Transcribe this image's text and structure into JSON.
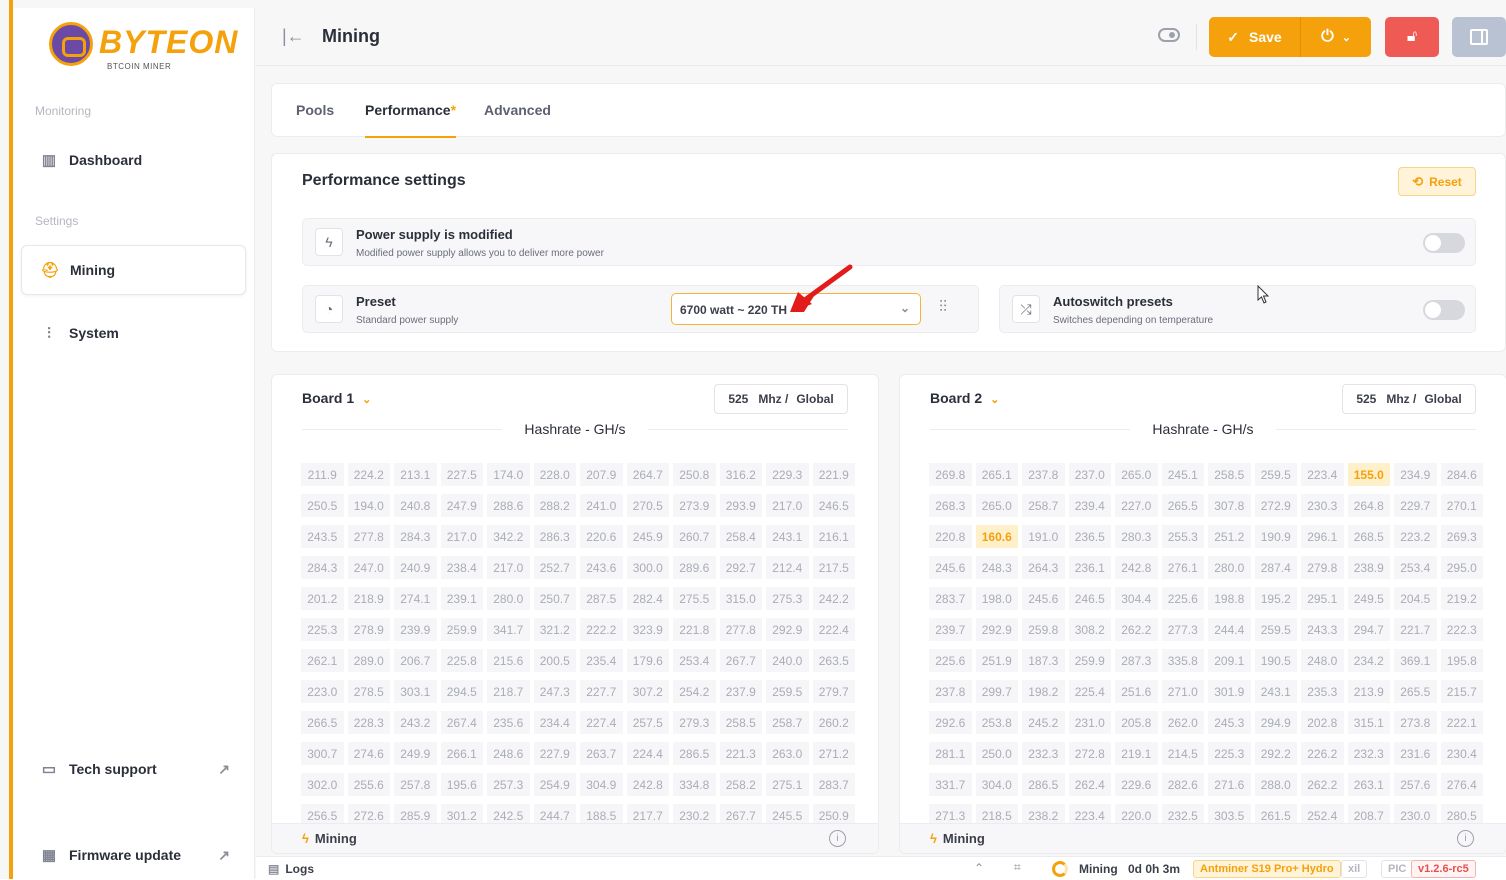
{
  "brand": {
    "name": "BYTEON",
    "tagline": "BTCOIN MINER"
  },
  "sidebar": {
    "sections": [
      "Monitoring",
      "Settings"
    ],
    "items": [
      {
        "label": "Dashboard",
        "icon": "chart-icon"
      },
      {
        "label": "Mining",
        "icon": "helmet-icon",
        "active": true
      },
      {
        "label": "System",
        "icon": "sliders-icon"
      }
    ],
    "bottom": [
      {
        "label": "Tech support",
        "icon": "chat-icon"
      },
      {
        "label": "Firmware update",
        "icon": "chip-icon"
      }
    ]
  },
  "topbar": {
    "title": "Mining",
    "save_label": "Save"
  },
  "tabs": [
    {
      "label": "Pools"
    },
    {
      "label": "Performance",
      "star": "*"
    },
    {
      "label": "Advanced"
    }
  ],
  "performance": {
    "title": "Performance settings",
    "reset_label": "Reset",
    "power_supply": {
      "title": "Power supply is modified",
      "subtitle": "Modified power supply allows you to deliver more power",
      "enabled": false
    },
    "preset": {
      "title": "Preset",
      "subtitle": "Standard power supply",
      "value": "6700 watt ~ 220 TH"
    },
    "autoswitch": {
      "title": "Autoswitch presets",
      "subtitle": "Switches depending on temperature",
      "enabled": false
    }
  },
  "boards": [
    {
      "name": "Board 1",
      "freq": "525",
      "freq_unit": "Mhz /",
      "scope": "Global",
      "hashrate_title": "Hashrate - GH/s",
      "status": "Mining",
      "highlight": [],
      "values": [
        [
          "211.9",
          "224.2",
          "213.1",
          "227.5",
          "174.0",
          "228.0",
          "207.9",
          "264.7",
          "250.8",
          "316.2",
          "229.3",
          "221.9"
        ],
        [
          "250.5",
          "194.0",
          "240.8",
          "247.9",
          "288.6",
          "288.2",
          "241.0",
          "270.5",
          "273.9",
          "293.9",
          "217.0",
          "246.5"
        ],
        [
          "243.5",
          "277.8",
          "284.3",
          "217.0",
          "342.2",
          "286.3",
          "220.6",
          "245.9",
          "260.7",
          "258.4",
          "243.1",
          "216.1"
        ],
        [
          "284.3",
          "247.0",
          "240.9",
          "238.4",
          "217.0",
          "252.7",
          "243.6",
          "300.0",
          "289.6",
          "292.7",
          "212.4",
          "217.5"
        ],
        [
          "201.2",
          "218.9",
          "274.1",
          "239.1",
          "280.0",
          "250.7",
          "287.5",
          "282.4",
          "275.5",
          "315.0",
          "275.3",
          "242.2"
        ],
        [
          "225.3",
          "278.9",
          "239.9",
          "259.9",
          "341.7",
          "321.2",
          "222.2",
          "323.9",
          "221.8",
          "277.8",
          "292.9",
          "222.4"
        ],
        [
          "262.1",
          "289.0",
          "206.7",
          "225.8",
          "215.6",
          "200.5",
          "235.4",
          "179.6",
          "253.4",
          "267.7",
          "240.0",
          "263.5"
        ],
        [
          "223.0",
          "278.5",
          "303.1",
          "294.5",
          "218.7",
          "247.3",
          "227.7",
          "307.2",
          "254.2",
          "237.9",
          "259.5",
          "279.7"
        ],
        [
          "266.5",
          "228.3",
          "243.2",
          "267.4",
          "235.6",
          "234.4",
          "227.4",
          "257.5",
          "279.3",
          "258.5",
          "258.7",
          "260.2"
        ],
        [
          "300.7",
          "274.6",
          "249.9",
          "266.1",
          "248.6",
          "227.9",
          "263.7",
          "224.4",
          "286.5",
          "221.3",
          "263.0",
          "271.2"
        ],
        [
          "302.0",
          "255.6",
          "257.8",
          "195.6",
          "257.3",
          "254.9",
          "304.9",
          "242.8",
          "334.8",
          "258.2",
          "275.1",
          "283.7"
        ],
        [
          "256.5",
          "272.6",
          "285.9",
          "301.2",
          "242.5",
          "244.7",
          "188.5",
          "217.7",
          "230.2",
          "267.7",
          "245.5",
          "250.9"
        ]
      ]
    },
    {
      "name": "Board 2",
      "freq": "525",
      "freq_unit": "Mhz /",
      "scope": "Global",
      "hashrate_title": "Hashrate - GH/s",
      "status": "Mining",
      "highlight": [
        "155.0",
        "160.6"
      ],
      "values": [
        [
          "269.8",
          "265.1",
          "237.8",
          "237.0",
          "265.0",
          "245.1",
          "258.5",
          "259.5",
          "223.4",
          "155.0",
          "234.9",
          "284.6"
        ],
        [
          "268.3",
          "265.0",
          "258.7",
          "239.4",
          "227.0",
          "265.5",
          "307.8",
          "272.9",
          "230.3",
          "264.8",
          "229.7",
          "270.1"
        ],
        [
          "220.8",
          "160.6",
          "191.0",
          "236.5",
          "280.3",
          "255.3",
          "251.2",
          "190.9",
          "296.1",
          "268.5",
          "223.2",
          "269.3"
        ],
        [
          "245.6",
          "248.3",
          "264.3",
          "236.1",
          "242.8",
          "276.1",
          "280.0",
          "287.4",
          "279.8",
          "238.9",
          "253.4",
          "295.0"
        ],
        [
          "283.7",
          "198.0",
          "245.6",
          "246.5",
          "304.4",
          "225.6",
          "198.8",
          "195.2",
          "295.1",
          "249.5",
          "204.5",
          "219.2"
        ],
        [
          "239.7",
          "292.9",
          "259.8",
          "308.2",
          "262.2",
          "277.3",
          "244.4",
          "259.5",
          "243.3",
          "294.7",
          "221.7",
          "222.3"
        ],
        [
          "225.6",
          "251.9",
          "187.3",
          "259.9",
          "287.3",
          "335.8",
          "209.1",
          "190.5",
          "248.0",
          "234.2",
          "369.1",
          "195.8"
        ],
        [
          "237.8",
          "299.7",
          "198.2",
          "225.4",
          "251.6",
          "271.0",
          "301.9",
          "243.1",
          "235.3",
          "213.9",
          "265.5",
          "215.7"
        ],
        [
          "292.6",
          "253.8",
          "245.2",
          "231.0",
          "205.8",
          "262.0",
          "245.3",
          "294.9",
          "202.8",
          "315.1",
          "273.8",
          "222.1"
        ],
        [
          "281.1",
          "250.0",
          "232.3",
          "272.8",
          "219.1",
          "214.5",
          "225.3",
          "292.2",
          "226.2",
          "232.3",
          "231.6",
          "230.4"
        ],
        [
          "331.7",
          "304.0",
          "286.5",
          "262.4",
          "229.6",
          "282.6",
          "271.6",
          "288.0",
          "262.2",
          "263.1",
          "257.6",
          "276.4"
        ],
        [
          "271.3",
          "218.5",
          "238.2",
          "223.4",
          "220.0",
          "232.5",
          "303.5",
          "261.5",
          "252.4",
          "208.7",
          "230.0",
          "280.5"
        ]
      ]
    }
  ],
  "statusbar": {
    "logs": "Logs",
    "mining": "Mining",
    "uptime": "0d 0h 3m",
    "model": "Antminer S19 Pro+ Hydro",
    "xil": "xil",
    "pic": "PIC",
    "version": "v1.2.6-rc5"
  },
  "colors": {
    "accent": "#f4a10c",
    "danger": "#ef5a54",
    "panel": "#b8c2d3"
  }
}
